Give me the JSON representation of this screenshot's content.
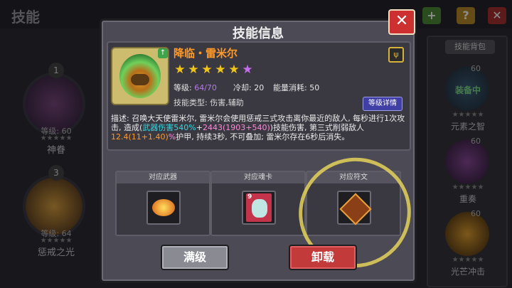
{
  "screen_title": "技能",
  "colors": {
    "accent": "#ff9a2a",
    "close": "#cc3030",
    "highlight": "#e5d25a"
  },
  "left_skills": [
    {
      "number": "1",
      "level": "等级: 60",
      "stars": "★★★★★",
      "name": "神眷"
    },
    {
      "number": "3",
      "level": "等级: 64",
      "stars": "★★★★★",
      "name": "惩戒之光"
    }
  ],
  "right_panel": {
    "tab_label": "技能背包",
    "cards": [
      {
        "level": "60",
        "equip_label": "装备中",
        "stars": "★★★★★",
        "name": "元素之智"
      },
      {
        "level": "60",
        "equip_label": "",
        "stars": "★★★★★",
        "name": "重奏"
      },
      {
        "level": "60",
        "equip_label": "",
        "stars": "★★★★★",
        "name": "光芒冲击"
      }
    ]
  },
  "dialog": {
    "title": "技能信息",
    "close_label": "✕",
    "skill": {
      "name": "降临・雷米尔",
      "stars": [
        "★",
        "★",
        "★",
        "★",
        "★",
        "★"
      ],
      "star_colors": [
        "#f0c419",
        "#f0c419",
        "#f0c419",
        "#f0c419",
        "#f0c419",
        "#c56cf0"
      ],
      "level_label": "等级:",
      "level_value": "64/70",
      "cooldown_label": "冷却:",
      "cooldown_value": "20",
      "energy_label": "能量消耗:",
      "energy_value": "50",
      "type_line": "技能类型: 伤害,辅助",
      "detail_button": "等级详情",
      "rune_icon_glyph": "ψ",
      "desc": {
        "p1": "描述: 召唤大天使雷米尔, 雷米尔会使用惩戒三式攻击离你最近的敌人, 每秒进行1次攻击, 造成(",
        "weapon_dmg": "武器伤害540%",
        "plus": "+",
        "flat": "2443(1903+540)",
        "p2": ")技能伤害, 第三式削弱敌人",
        "weaken": "12.4(11+1.40)",
        "pct": "%",
        "p3": "护甲, 持续3秒, 不可叠加; 雷米尔存在6秒后消失。"
      }
    },
    "slots": [
      {
        "header": "对应武器"
      },
      {
        "header": "对应魂卡",
        "card_number": "9"
      },
      {
        "header": "对应符文"
      }
    ],
    "max_button": "满级",
    "unload_button": "卸载"
  }
}
